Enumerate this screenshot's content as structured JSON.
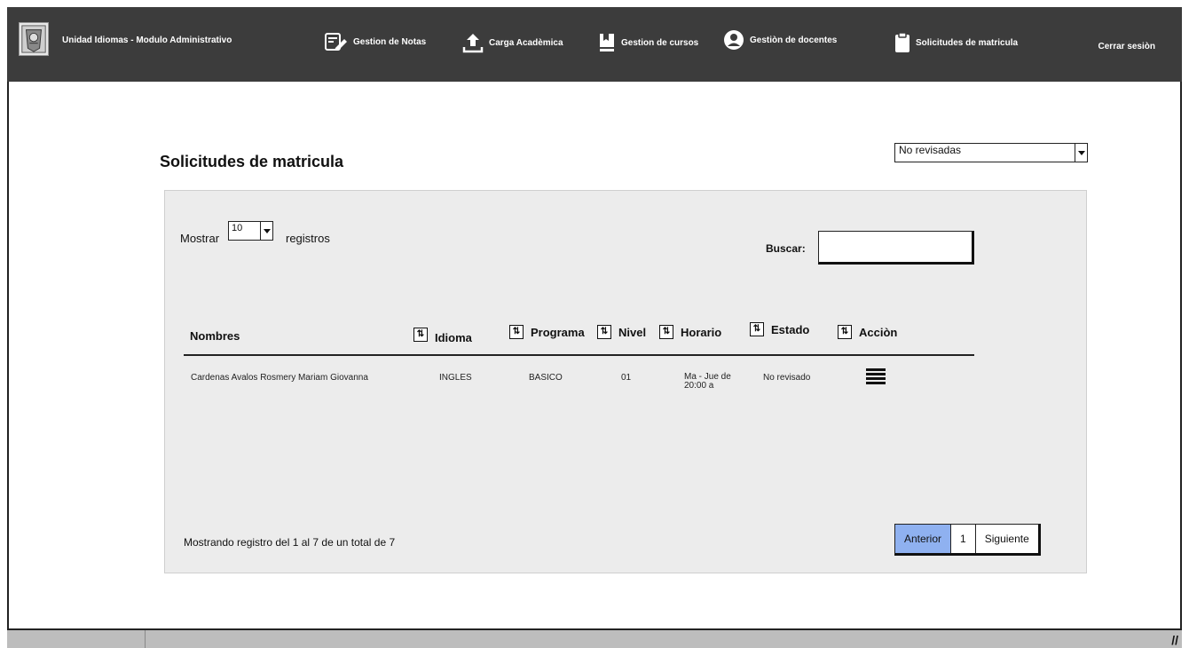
{
  "header": {
    "app_title": "Unidad Idiomas - Modulo Administrativo",
    "nav": [
      {
        "label": "Gestion de Notas",
        "icon": "edit-note-icon"
      },
      {
        "label": "Carga Acadèmica",
        "icon": "upload-icon"
      },
      {
        "label": "Gestion de cursos",
        "icon": "book-icon"
      },
      {
        "label": "Gestiòn de docentes",
        "icon": "user-circle-icon"
      },
      {
        "label": "Solicitudes de matricula",
        "icon": "clipboard-icon"
      }
    ],
    "logout_label": "Cerrar sesiòn"
  },
  "main": {
    "title": "Solicitudes de matricula",
    "filter": {
      "selected": "No revisadas"
    }
  },
  "table_controls": {
    "show_label": "Mostrar",
    "page_length": "10",
    "records_label": "registros",
    "search_label": "Buscar:",
    "search_value": ""
  },
  "table": {
    "columns": [
      "Nombres",
      "Idioma",
      "Programa",
      "Nivel",
      "Horario",
      "Estado",
      "Acciòn"
    ],
    "rows": [
      {
        "nombres": "Cardenas Avalos Rosmery Mariam Giovanna",
        "idioma": "INGLES",
        "programa": "BASICO",
        "nivel": "01",
        "horario": "Ma - Jue de 20:00 a",
        "estado": "No revisado",
        "accion_icon": "menu-icon"
      }
    ]
  },
  "footer": {
    "info": "Mostrando registro del 1 al 7 de un total de 7",
    "pagination": {
      "prev": "Anterior",
      "current": "1",
      "next": "Siguiente"
    }
  },
  "colors": {
    "topbar": "#3c3c3c",
    "panel": "#ececec",
    "active_page": "#8fb1f0"
  }
}
